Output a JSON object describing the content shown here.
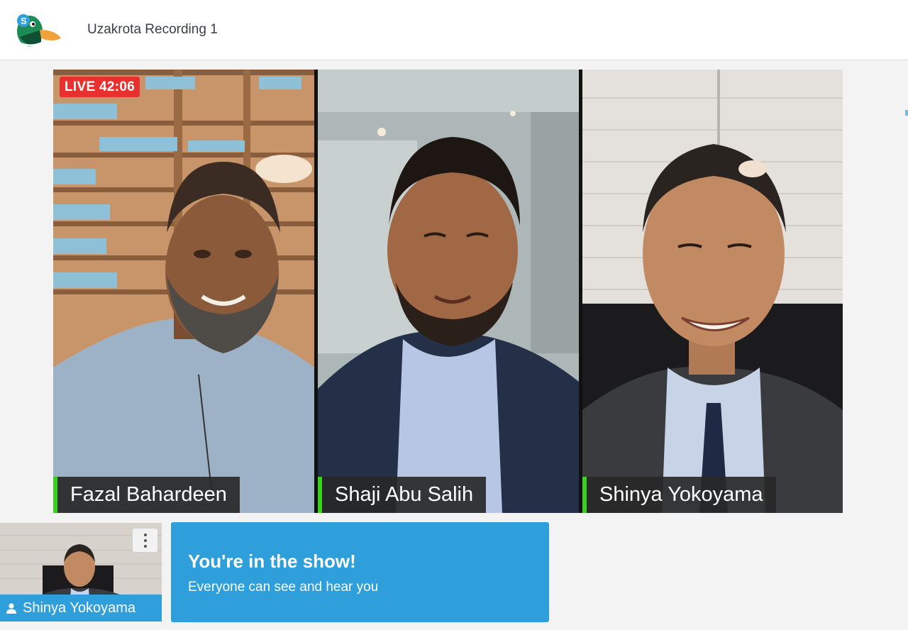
{
  "header": {
    "title": "Uzakrota Recording 1",
    "logo_icon": "duck-logo-icon"
  },
  "stage": {
    "live_badge": "LIVE 42:06",
    "participants": [
      {
        "name": "Fazal Bahardeen"
      },
      {
        "name": "Shaji Abu Salih"
      },
      {
        "name": "Shinya Yokoyama"
      }
    ]
  },
  "self_view": {
    "name": "Shinya Yokoyama",
    "menu_icon": "more-vertical-icon",
    "person_icon": "person-icon"
  },
  "banner": {
    "title": "You're in the show!",
    "subtitle": "Everyone can see and hear you"
  },
  "colors": {
    "accent": "#2f9fdb",
    "live": "#e8312f",
    "speaking": "#39d21b"
  }
}
